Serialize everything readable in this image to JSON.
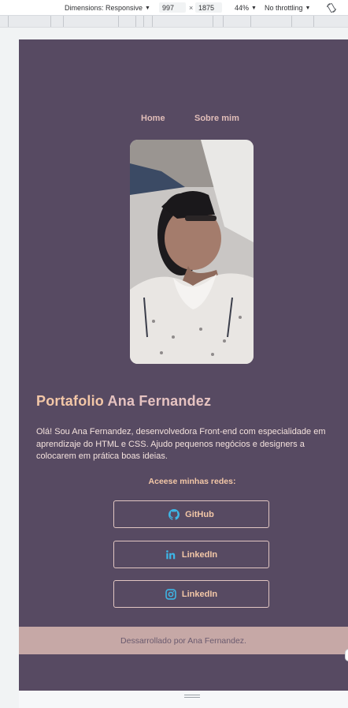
{
  "devtools": {
    "dimensions_label": "Dimensions: Responsive",
    "width_value": "997",
    "times": "×",
    "height_value": "1875",
    "zoom": "44%",
    "throttling": "No throttling",
    "rotate_icon": "rotate-icon"
  },
  "nav": {
    "items": [
      {
        "label": "Home"
      },
      {
        "label": "Sobre mim"
      }
    ]
  },
  "profile": {
    "title_highlight": "Portafolio",
    "title_name": "Ana Fernandez",
    "bio_lines": [
      "Olá! Sou Ana Fernandez, desenvolvedora Front-end com especialidade em",
      "aprendizaje do HTML e CSS. Ajudo pequenos negócios e designers a",
      "colocarem em prática boas ideias."
    ]
  },
  "socials": {
    "title": "Aceese minhas redes:",
    "buttons": [
      {
        "label": "GitHub",
        "icon": "github-icon"
      },
      {
        "label": "LinkedIn",
        "icon": "linkedin-icon"
      },
      {
        "label": "LinkedIn",
        "icon": "instagram-icon"
      }
    ]
  },
  "footer": {
    "text": "Dessarrollado por Ana Fernandez."
  },
  "colors": {
    "page_bg": "#574a62",
    "accent_peach": "#f3c7a7",
    "footer_bg": "#c6a8a6",
    "icon_blue": "#3db6e6"
  }
}
